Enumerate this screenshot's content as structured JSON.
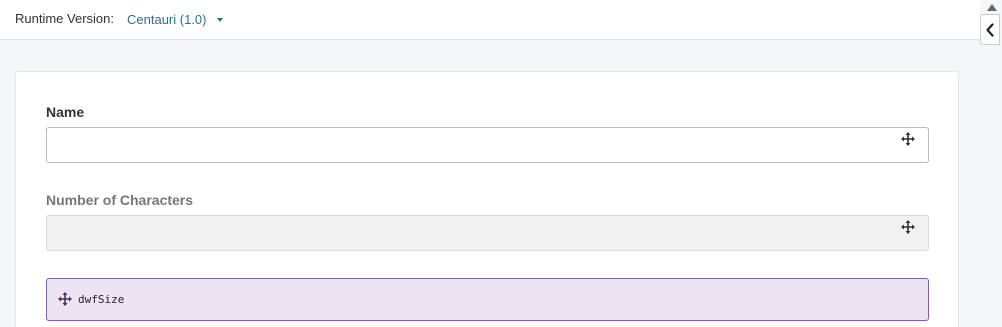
{
  "runtime": {
    "label": "Runtime Version:",
    "selected": "Centauri (1.0)"
  },
  "fields": {
    "name": {
      "label": "Name",
      "value": ""
    },
    "num_chars": {
      "label": "Number of Characters",
      "value": ""
    }
  },
  "dwf_block": {
    "text": "dwfSize"
  },
  "icons": {
    "dropdown": "caret-down-icon",
    "drag": "move-icon",
    "collapse": "chevron-left-icon",
    "scroll": "scroll-up-arrow-icon"
  },
  "colors": {
    "link": "#2f6f86",
    "dwf_bg": "#ece4f2",
    "dwf_border": "#8a5ca8"
  }
}
